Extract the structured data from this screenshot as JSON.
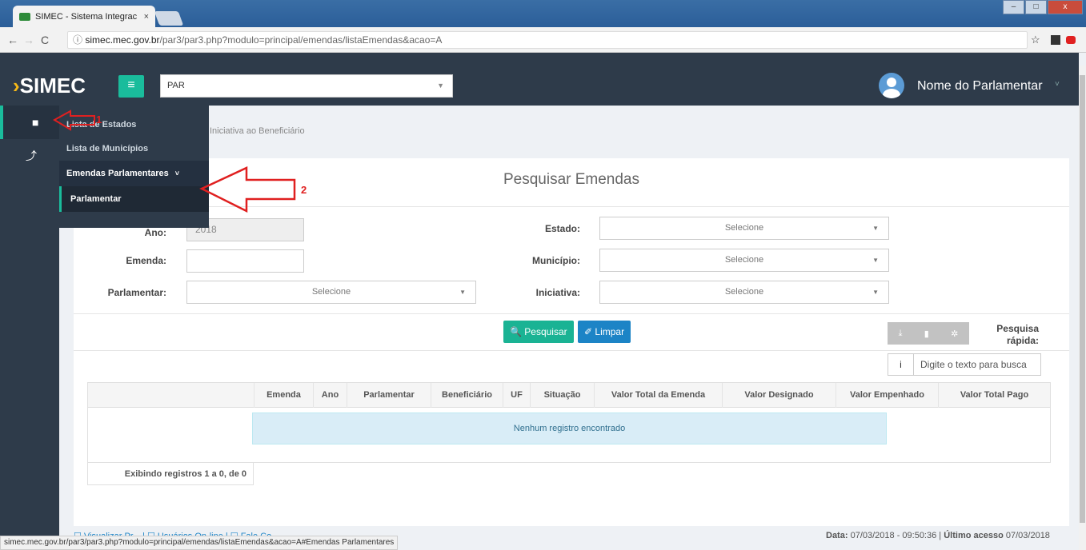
{
  "browser": {
    "tab_title": "SIMEC - Sistema Integrac",
    "tab_close": "×",
    "url_domain": "simec.mec.gov.br",
    "url_path": "/par3/par3.php?modulo=principal/emendas/listaEmendas&acao=A",
    "url_info_icon": "ⓘ",
    "back": "←",
    "forward": "→",
    "reload": "C",
    "star": "☆",
    "win_min": "–",
    "win_max": "□",
    "win_close": "x",
    "status_url": "simec.mec.gov.br/par3/par3.php?modulo=principal/emendas/listaEmendas&acao=A#Emendas Parlamentares"
  },
  "header": {
    "logo_text": "SIMEC",
    "logo_arrow": "›",
    "menu_icon": "≡",
    "module_select": "PAR",
    "user_name": "Nome do Parlamentar",
    "user_caret": "˅"
  },
  "leftnav": {
    "items": [
      {
        "icon": "grid-icon",
        "glyph": "■"
      },
      {
        "icon": "chart-line-icon",
        "glyph": "⤴"
      }
    ]
  },
  "flyout": {
    "items": [
      {
        "label": "Lista de Estados"
      },
      {
        "label": "Lista de Municípios"
      },
      {
        "label": "Emendas Parlamentares",
        "chevron": "˅"
      },
      {
        "label": "Parlamentar"
      }
    ]
  },
  "breadcrumb": "Iniciativa ao Beneficiário",
  "annotations": {
    "one": "1",
    "two": "2"
  },
  "form": {
    "title": "Pesquisar Emendas",
    "ano_label": "Ano:",
    "ano_value": "2018",
    "emenda_label": "Emenda:",
    "emenda_value": "",
    "parlamentar_label": "Parlamentar:",
    "parlamentar_value": "Selecione",
    "estado_label": "Estado:",
    "estado_value": "Selecione",
    "municipio_label": "Município:",
    "municipio_value": "Selecione",
    "iniciativa_label": "Iniciativa:",
    "iniciativa_value": "Selecione",
    "caret": "▼"
  },
  "actions": {
    "search": "🔍 Pesquisar",
    "clear": "✐ Limpar",
    "tool_download": "⤓",
    "tool_file": "▮",
    "tool_gear": "✲",
    "quick_label": "Pesquisa rápida:",
    "quick_info": "i",
    "quick_placeholder": "Digite o texto para busca"
  },
  "table": {
    "columns": [
      "Emenda",
      "Ano",
      "Parlamentar",
      "Beneficiário",
      "UF",
      "Situação",
      "Valor Total da Emenda",
      "Valor Designado",
      "Valor Empenhado",
      "Valor Total Pago"
    ],
    "empty_message": "Nenhum registro encontrado",
    "showing": "Exibindo registros 1 a 0, de 0"
  },
  "footer": {
    "left": "☐ Visualizar Pr...  |  ☐ Usuários On-line  |  ☐ Fale Co...",
    "date_label": "Data:",
    "date_value": "07/03/2018 - 09:50:36",
    "last_label": "Último acesso",
    "last_value": "07/03/2018"
  }
}
